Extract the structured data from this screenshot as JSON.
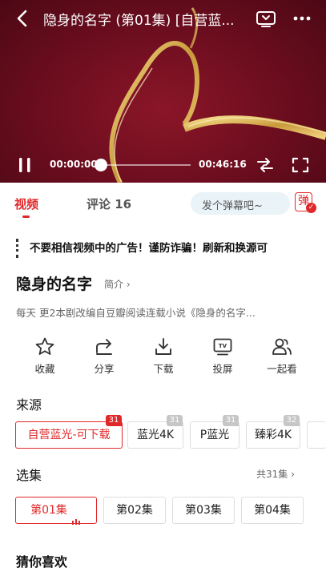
{
  "player": {
    "title": "隐身的名字 (第01集) [自营蓝...",
    "time_current": "00:00:00",
    "time_total": "00:46:16",
    "progress": 0
  },
  "tabs": {
    "video_label": "视频",
    "comments_label": "评论 16",
    "danmu_placeholder": "发个弹幕吧~",
    "danmu_glyph": "弹"
  },
  "warning_text": "不要相信视频中的广告！谨防诈骗！刷新和换源可",
  "drama": {
    "title": "隐身的名字",
    "intro_label": "简介 ›",
    "description": "每天 更2本剧改编自豆瓣阅读连载小说《隐身的名字..."
  },
  "actions": [
    {
      "label": "收藏",
      "icon": "star-icon"
    },
    {
      "label": "分享",
      "icon": "share-icon"
    },
    {
      "label": "下载",
      "icon": "download-icon"
    },
    {
      "label": "投屏",
      "icon": "cast-tv-icon"
    },
    {
      "label": "一起看",
      "icon": "watch-together-icon"
    }
  ],
  "sources": {
    "heading": "来源",
    "items": [
      {
        "label": "自营蓝光-可下载",
        "count": "31",
        "active": true
      },
      {
        "label": "蓝光4K",
        "count": "31",
        "active": false
      },
      {
        "label": "P蓝光",
        "count": "31",
        "active": false
      },
      {
        "label": "臻彩4K",
        "count": "32",
        "active": false
      }
    ]
  },
  "episodes": {
    "heading": "选集",
    "all_label": "共31集 ›",
    "items": [
      {
        "label": "第01集",
        "active": true
      },
      {
        "label": "第02集",
        "active": false
      },
      {
        "label": "第03集",
        "active": false
      },
      {
        "label": "第04集",
        "active": false
      }
    ]
  },
  "recommend": {
    "heading": "猜你喜欢"
  },
  "colors": {
    "accent": "#e0282a",
    "player_bg": "#6a0d1e",
    "ribbon": "#d9b25a"
  }
}
